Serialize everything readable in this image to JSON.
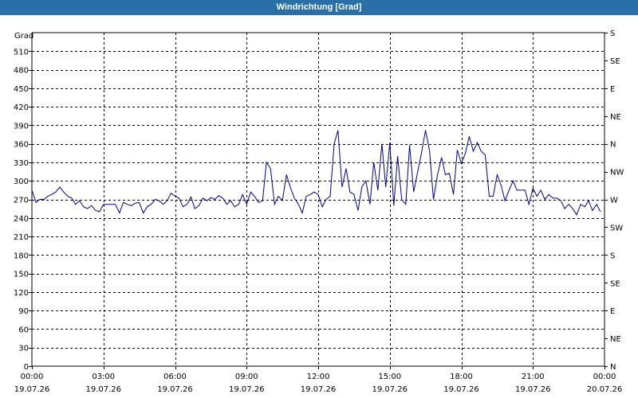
{
  "window": {
    "title": "Windrichtung [Grad]"
  },
  "chart_data": {
    "type": "line",
    "title": "Windrichtung [Grad]",
    "ylabel": "Grad",
    "xlabel": "",
    "ylim": [
      0,
      540
    ],
    "xlim_hours": [
      0,
      24
    ],
    "grid": true,
    "y_ticks": [
      0,
      30,
      60,
      90,
      120,
      150,
      180,
      210,
      240,
      270,
      300,
      330,
      360,
      390,
      420,
      450,
      480,
      510
    ],
    "right_ticks": [
      {
        "value": 0,
        "label": "N"
      },
      {
        "value": 45,
        "label": "NE"
      },
      {
        "value": 90,
        "label": "E"
      },
      {
        "value": 135,
        "label": "SE"
      },
      {
        "value": 180,
        "label": "S"
      },
      {
        "value": 225,
        "label": "SW"
      },
      {
        "value": 270,
        "label": "W"
      },
      {
        "value": 315,
        "label": "NW"
      },
      {
        "value": 360,
        "label": "N"
      },
      {
        "value": 405,
        "label": "NE"
      },
      {
        "value": 450,
        "label": "E"
      },
      {
        "value": 495,
        "label": "SE"
      },
      {
        "value": 540,
        "label": "S"
      }
    ],
    "x_ticks": [
      {
        "time": "00:00",
        "date": "19.07.26"
      },
      {
        "time": "03:00",
        "date": "19.07.26"
      },
      {
        "time": "06:00",
        "date": "19.07.26"
      },
      {
        "time": "09:00",
        "date": "19.07.26"
      },
      {
        "time": "12:00",
        "date": "19.07.26"
      },
      {
        "time": "15:00",
        "date": "19.07.26"
      },
      {
        "time": "18:00",
        "date": "19.07.26"
      },
      {
        "time": "21:00",
        "date": "19.07.26"
      },
      {
        "time": "00:00",
        "date": "20.07.26"
      }
    ],
    "series": [
      {
        "color": "#00008b",
        "hours": [
          0.0,
          0.17,
          0.33,
          0.5,
          0.67,
          0.83,
          1.0,
          1.17,
          1.33,
          1.5,
          1.67,
          1.83,
          2.0,
          2.17,
          2.33,
          2.5,
          2.67,
          2.83,
          3.0,
          3.17,
          3.33,
          3.5,
          3.67,
          3.83,
          4.0,
          4.17,
          4.33,
          4.5,
          4.67,
          4.83,
          5.0,
          5.17,
          5.33,
          5.5,
          5.67,
          5.83,
          6.0,
          6.17,
          6.33,
          6.5,
          6.67,
          6.83,
          7.0,
          7.17,
          7.33,
          7.5,
          7.67,
          7.83,
          8.0,
          8.17,
          8.33,
          8.5,
          8.67,
          8.83,
          9.0,
          9.17,
          9.33,
          9.5,
          9.67,
          9.83,
          10.0,
          10.17,
          10.33,
          10.5,
          10.67,
          10.83,
          11.0,
          11.17,
          11.33,
          11.5,
          11.67,
          11.83,
          12.0,
          12.17,
          12.33,
          12.5,
          12.67,
          12.83,
          13.0,
          13.17,
          13.33,
          13.5,
          13.67,
          13.83,
          14.0,
          14.17,
          14.33,
          14.5,
          14.67,
          14.83,
          15.0,
          15.17,
          15.33,
          15.5,
          15.67,
          15.83,
          16.0,
          16.17,
          16.33,
          16.5,
          16.67,
          16.83,
          17.0,
          17.17,
          17.33,
          17.5,
          17.67,
          17.83,
          18.0,
          18.17,
          18.33,
          18.5,
          18.67,
          18.83,
          19.0,
          19.17,
          19.33,
          19.5,
          19.67,
          19.83,
          20.0,
          20.17,
          20.33,
          20.5,
          20.67,
          20.83,
          21.0,
          21.17,
          21.33,
          21.5,
          21.67,
          21.83,
          22.0,
          22.17,
          22.33,
          22.5,
          22.67,
          22.83,
          23.0,
          23.17,
          23.33,
          23.5,
          23.67,
          23.83
        ],
        "values": [
          285,
          265,
          270,
          270,
          275,
          278,
          282,
          290,
          282,
          275,
          272,
          262,
          268,
          258,
          255,
          260,
          252,
          250,
          262,
          262,
          262,
          262,
          248,
          265,
          262,
          260,
          264,
          265,
          248,
          258,
          262,
          270,
          268,
          262,
          268,
          280,
          275,
          272,
          258,
          262,
          274,
          255,
          260,
          272,
          268,
          273,
          270,
          276,
          272,
          262,
          268,
          258,
          262,
          278,
          262,
          282,
          275,
          265,
          268,
          330,
          320,
          262,
          275,
          268,
          310,
          290,
          272,
          262,
          248,
          275,
          278,
          282,
          278,
          258,
          270,
          275,
          360,
          382,
          290,
          320,
          282,
          278,
          252,
          290,
          300,
          262,
          330,
          285,
          360,
          290,
          362,
          260,
          340,
          270,
          262,
          358,
          282,
          315,
          345,
          382,
          348,
          270,
          310,
          338,
          310,
          312,
          278,
          350,
          328,
          345,
          372,
          348,
          362,
          348,
          342,
          275,
          275,
          310,
          292,
          268,
          285,
          300,
          285,
          285,
          285,
          262,
          288,
          275,
          285,
          270,
          278,
          272,
          272,
          268,
          255,
          262,
          255,
          245,
          262,
          258,
          268,
          252,
          262,
          250
        ]
      }
    ]
  }
}
